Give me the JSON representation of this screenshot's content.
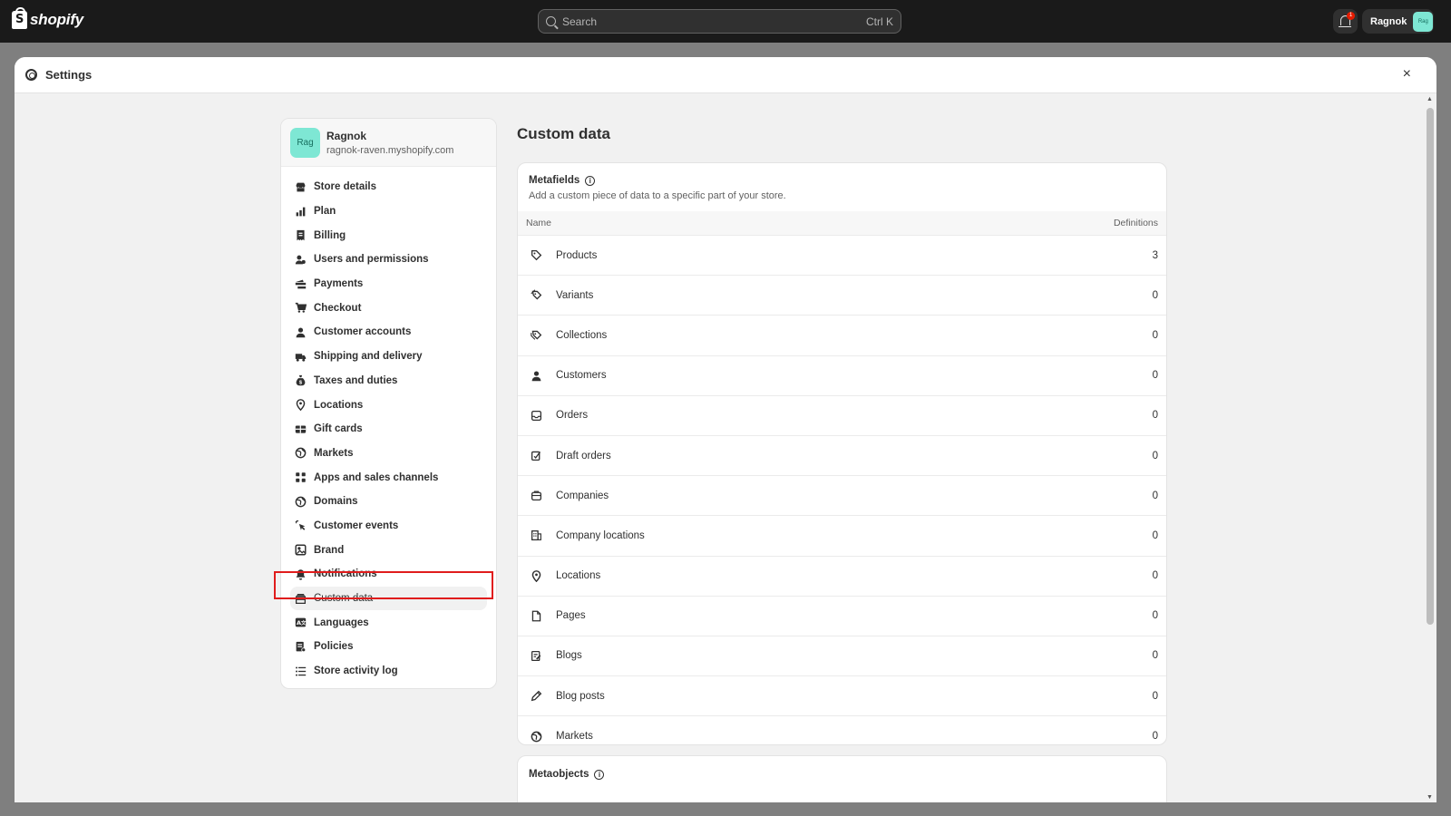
{
  "topbar": {
    "brand": "shopify",
    "search_placeholder": "Search",
    "search_shortcut": "Ctrl K",
    "notification_count": "1",
    "account_name": "Ragnok",
    "account_avatar": "Rag"
  },
  "modal": {
    "title": "Settings",
    "close_label": "×"
  },
  "store": {
    "avatar": "Rag",
    "name": "Ragnok",
    "url": "ragnok-raven.myshopify.com"
  },
  "nav": {
    "items": [
      {
        "label": "Store details",
        "icon": "store-icon"
      },
      {
        "label": "Plan",
        "icon": "plan-icon"
      },
      {
        "label": "Billing",
        "icon": "receipt-icon"
      },
      {
        "label": "Users and permissions",
        "icon": "users-icon"
      },
      {
        "label": "Payments",
        "icon": "payments-icon"
      },
      {
        "label": "Checkout",
        "icon": "cart-icon"
      },
      {
        "label": "Customer accounts",
        "icon": "person-icon"
      },
      {
        "label": "Shipping and delivery",
        "icon": "truck-icon"
      },
      {
        "label": "Taxes and duties",
        "icon": "money-bag-icon"
      },
      {
        "label": "Locations",
        "icon": "location-pin-icon"
      },
      {
        "label": "Gift cards",
        "icon": "gift-card-icon"
      },
      {
        "label": "Markets",
        "icon": "globe-icon"
      },
      {
        "label": "Apps and sales channels",
        "icon": "apps-icon"
      },
      {
        "label": "Domains",
        "icon": "globe-icon"
      },
      {
        "label": "Customer events",
        "icon": "cursor-icon"
      },
      {
        "label": "Brand",
        "icon": "brand-icon"
      },
      {
        "label": "Notifications",
        "icon": "bell-icon"
      },
      {
        "label": "Custom data",
        "icon": "custom-data-icon",
        "active": true
      },
      {
        "label": "Languages",
        "icon": "language-icon"
      },
      {
        "label": "Policies",
        "icon": "policy-icon"
      },
      {
        "label": "Store activity log",
        "icon": "list-icon"
      }
    ]
  },
  "main": {
    "page_title": "Custom data",
    "metafields": {
      "title": "Metafields",
      "subtitle": "Add a custom piece of data to a specific part of your store.",
      "col_name": "Name",
      "col_definitions": "Definitions",
      "rows": [
        {
          "name": "Products",
          "count": "3",
          "icon": "tag-icon"
        },
        {
          "name": "Variants",
          "count": "0",
          "icon": "variant-tag-icon"
        },
        {
          "name": "Collections",
          "count": "0",
          "icon": "collection-icon"
        },
        {
          "name": "Customers",
          "count": "0",
          "icon": "person-icon"
        },
        {
          "name": "Orders",
          "count": "0",
          "icon": "inbox-icon"
        },
        {
          "name": "Draft orders",
          "count": "0",
          "icon": "draft-order-icon"
        },
        {
          "name": "Companies",
          "count": "0",
          "icon": "company-icon"
        },
        {
          "name": "Company locations",
          "count": "0",
          "icon": "building-icon"
        },
        {
          "name": "Locations",
          "count": "0",
          "icon": "location-pin-icon"
        },
        {
          "name": "Pages",
          "count": "0",
          "icon": "page-icon"
        },
        {
          "name": "Blogs",
          "count": "0",
          "icon": "blog-icon"
        },
        {
          "name": "Blog posts",
          "count": "0",
          "icon": "pencil-icon"
        },
        {
          "name": "Markets",
          "count": "0",
          "icon": "globe-icon"
        }
      ]
    },
    "metaobjects": {
      "title": "Metaobjects"
    }
  }
}
